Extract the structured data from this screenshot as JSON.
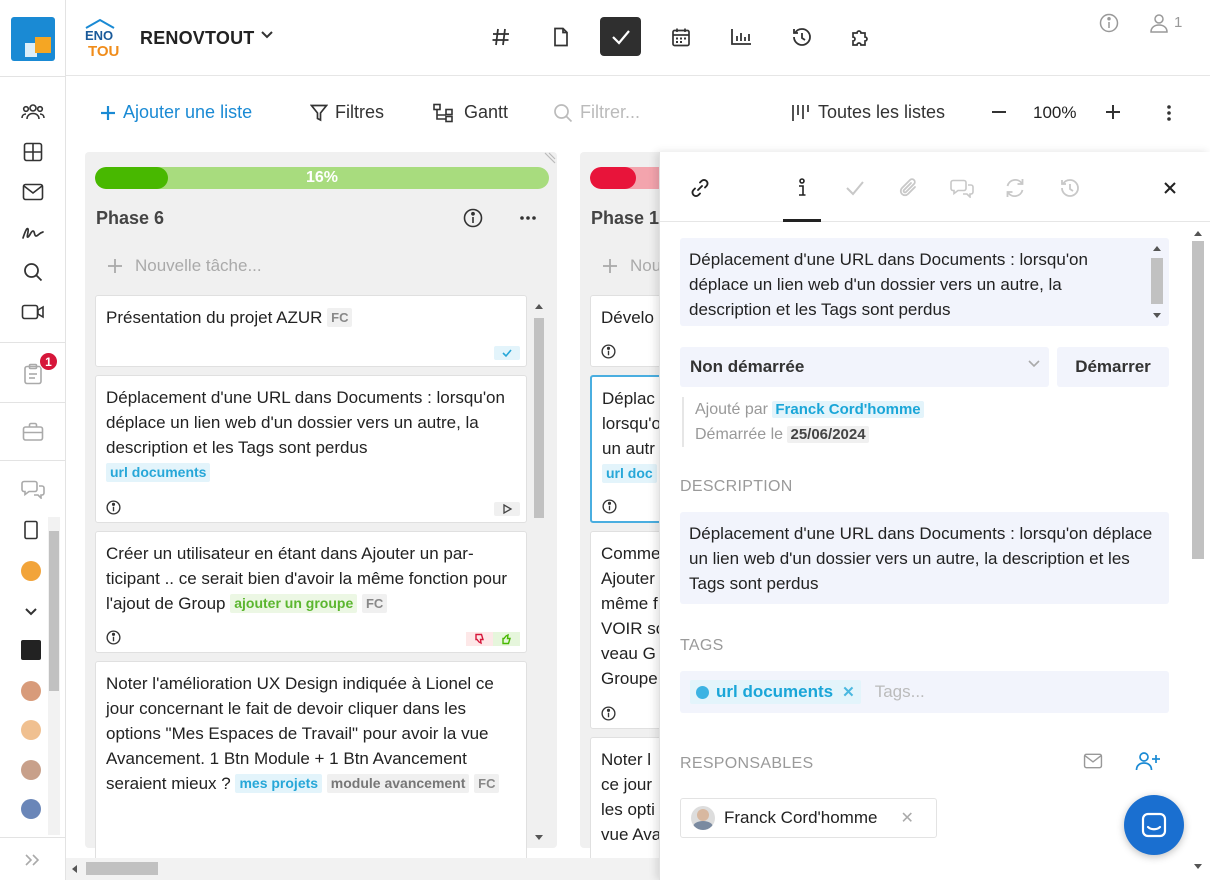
{
  "project": {
    "name": "RENOVTOUT",
    "logo_text_top": "ENO",
    "logo_text_bottom": "TOU"
  },
  "sidebar": {
    "notification_count": "1"
  },
  "header": {
    "user_count": "1"
  },
  "toolbar": {
    "add_list": "Ajouter une liste",
    "filters": "Filtres",
    "gantt": "Gantt",
    "filter_placeholder": "Filtrer...",
    "all_lists": "Toutes les listes",
    "zoom": "100%"
  },
  "columns": [
    {
      "title": "Phase 6",
      "progress_label": "16%",
      "progress_value": 16,
      "new_task": "Nouvelle tâche...",
      "cards": [
        {
          "text": "Présentation du projet AZUR",
          "tags": [],
          "initials": "FC"
        },
        {
          "text": "Déplacement d'une URL dans Documents : lorsqu'on déplace un lien web d'un dossier vers un autre, la description et les Tags sont perdus",
          "tags": [
            "url documents"
          ],
          "initials": ""
        },
        {
          "text": "Créer un utilisateur en étant dans Ajouter un par-ticipant .. ce serait bien d'avoir la même fonction pour l'ajout de Group",
          "tags": [
            "ajouter un groupe"
          ],
          "initials": "FC"
        },
        {
          "text": "Noter l'amélioration UX Design indiquée à Lionel ce jour concernant le fait de devoir cliquer dans les options \"Mes Espaces de Travail\" pour avoir la vue Avancement. 1 Btn Module + 1 Btn Avancement seraient mieux ?",
          "tags": [
            "mes projets",
            "module avancement"
          ],
          "initials": "FC"
        }
      ]
    },
    {
      "title": "Phase 1",
      "new_task": "Nou",
      "cards": [
        {
          "text": "Dévelo"
        },
        {
          "lines": [
            "Déplac",
            "lorsqu'o",
            "un autr"
          ],
          "tag": "url doc"
        },
        {
          "lines": [
            "Comme",
            "Ajouter",
            "même f",
            "VOIR so",
            "veau G",
            "Groupe"
          ]
        },
        {
          "lines": [
            "Noter l",
            "ce jour",
            "les opti",
            "vue Ava"
          ]
        }
      ]
    }
  ],
  "panel": {
    "title_text": "Déplacement d'une URL dans Documents : lorsqu'on déplace un lien web d'un dossier vers un autre, la description et les Tags sont perdus",
    "status": "Non démarrée",
    "start_button": "Démarrer",
    "added_by_label": "Ajouté par",
    "added_by": "Franck Cord'homme",
    "started_label": "Démarrée le",
    "started_date": "25/06/2024",
    "description_label": "DESCRIPTION",
    "description": "Déplacement d'une URL dans Documents : lorsqu'on déplace un lien web d'un dossier vers un autre, la description et les Tags sont perdus",
    "tags_label": "TAGS",
    "tag": "url documents",
    "tags_placeholder": "Tags...",
    "responsables_label": "RESPONSABLES",
    "responsable": "Franck Cord'homme"
  }
}
